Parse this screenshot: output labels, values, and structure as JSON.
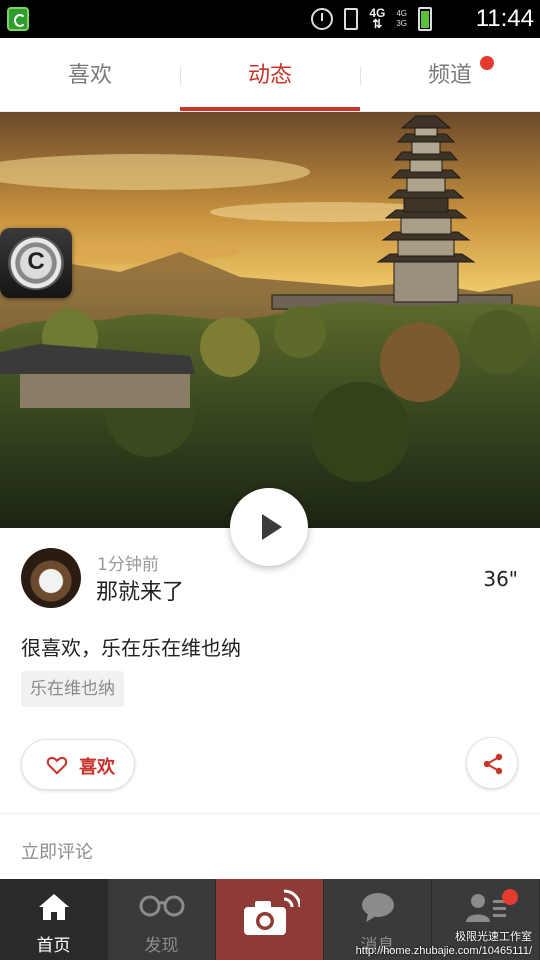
{
  "status_bar": {
    "time": "11:44",
    "network_label": "4G",
    "signal_labels": [
      "4G",
      "3G"
    ],
    "icons": [
      "app-shield-icon",
      "alarm-icon",
      "phone-vibrate-icon",
      "data-arrows-icon",
      "signal-icon",
      "battery-charging-icon"
    ]
  },
  "tabs": [
    {
      "label": "喜欢",
      "active": false
    },
    {
      "label": "动态",
      "active": true
    },
    {
      "label": "频道",
      "active": false,
      "badge": true
    }
  ],
  "colors": {
    "accent": "#c8332a",
    "badge": "#e53a2f",
    "nav_bg": "#3a3a3a",
    "camera_bg": "#8e3a36"
  },
  "post": {
    "time_ago": "1分钟前",
    "title": "那就来了",
    "duration": "36\"",
    "body": "很喜欢，乐在乐在维也纳",
    "tag": "乐在维也纳",
    "like_label": "喜欢",
    "comment_prompt": "立即评论"
  },
  "bottom_nav": [
    {
      "label": "首页",
      "icon": "home-icon",
      "active": true
    },
    {
      "label": "发现",
      "icon": "glasses-icon",
      "active": false
    },
    {
      "label": "",
      "icon": "camera-icon",
      "active": false
    },
    {
      "label": "消息",
      "icon": "chat-bubble-icon",
      "active": false
    },
    {
      "label": "",
      "icon": "contacts-icon",
      "active": false,
      "badge": true
    }
  ],
  "watermark": {
    "line1": "极限光速工作室",
    "line2": "http://home.zhubajie.com/10465111/"
  }
}
